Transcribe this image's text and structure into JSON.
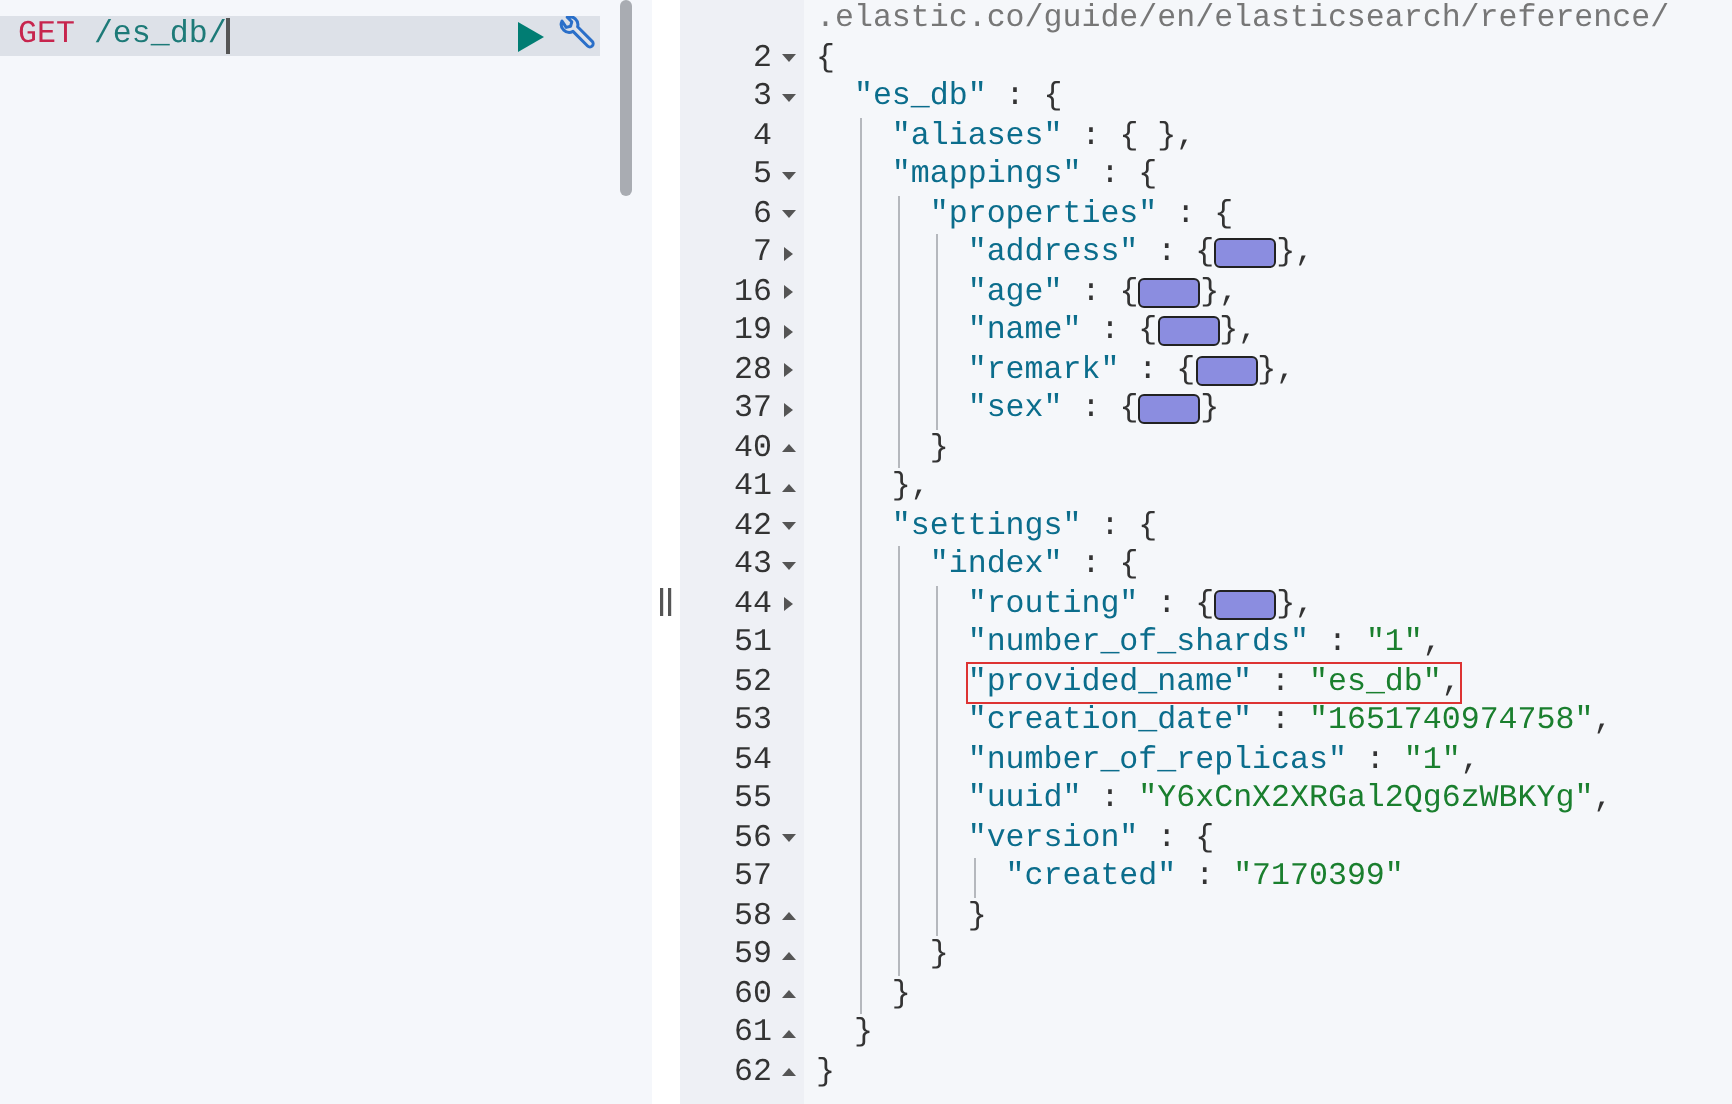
{
  "request": {
    "method": "GET",
    "path": "/es_db/"
  },
  "response": {
    "rows": [
      {
        "line": "",
        "fold_start": false,
        "fold_end": false,
        "code": [
          {
            "kind": "comment",
            "text": ".elastic.co/guide/en/elasticsearch/reference/"
          }
        ]
      },
      {
        "line": "2",
        "fold_start": true,
        "expanded": true,
        "fold_end": false,
        "code": [
          {
            "kind": "punct",
            "text": "{"
          }
        ]
      },
      {
        "line": "3",
        "fold_start": true,
        "expanded": true,
        "fold_end": false,
        "code": [
          {
            "kind": "key",
            "text": "  \"es_db\""
          },
          {
            "kind": "punct",
            "text": " : {"
          }
        ]
      },
      {
        "line": "4",
        "fold_start": false,
        "fold_end": false,
        "code": [
          {
            "kind": "key",
            "text": "    \"aliases\""
          },
          {
            "kind": "punct",
            "text": " : { },"
          }
        ]
      },
      {
        "line": "5",
        "fold_start": true,
        "expanded": true,
        "fold_end": false,
        "code": [
          {
            "kind": "key",
            "text": "    \"mappings\""
          },
          {
            "kind": "punct",
            "text": " : {"
          }
        ]
      },
      {
        "line": "6",
        "fold_start": true,
        "expanded": true,
        "fold_end": false,
        "code": [
          {
            "kind": "key",
            "text": "      \"properties\""
          },
          {
            "kind": "punct",
            "text": " : {"
          }
        ]
      },
      {
        "line": "7",
        "fold_start": true,
        "expanded": false,
        "fold_end": false,
        "code": [
          {
            "kind": "key",
            "text": "        \"address\""
          },
          {
            "kind": "punct",
            "text": " : {"
          },
          {
            "kind": "widget"
          },
          {
            "kind": "punct",
            "text": "},"
          }
        ]
      },
      {
        "line": "16",
        "fold_start": true,
        "expanded": false,
        "fold_end": false,
        "code": [
          {
            "kind": "key",
            "text": "        \"age\""
          },
          {
            "kind": "punct",
            "text": " : {"
          },
          {
            "kind": "widget"
          },
          {
            "kind": "punct",
            "text": "},"
          }
        ]
      },
      {
        "line": "19",
        "fold_start": true,
        "expanded": false,
        "fold_end": false,
        "code": [
          {
            "kind": "key",
            "text": "        \"name\""
          },
          {
            "kind": "punct",
            "text": " : {"
          },
          {
            "kind": "widget"
          },
          {
            "kind": "punct",
            "text": "},"
          }
        ]
      },
      {
        "line": "28",
        "fold_start": true,
        "expanded": false,
        "fold_end": false,
        "code": [
          {
            "kind": "key",
            "text": "        \"remark\""
          },
          {
            "kind": "punct",
            "text": " : {"
          },
          {
            "kind": "widget"
          },
          {
            "kind": "punct",
            "text": "},"
          }
        ]
      },
      {
        "line": "37",
        "fold_start": true,
        "expanded": false,
        "fold_end": false,
        "code": [
          {
            "kind": "key",
            "text": "        \"sex\""
          },
          {
            "kind": "punct",
            "text": " : {"
          },
          {
            "kind": "widget"
          },
          {
            "kind": "punct",
            "text": "}"
          }
        ]
      },
      {
        "line": "40",
        "fold_start": false,
        "fold_end": true,
        "code": [
          {
            "kind": "punct",
            "text": "      }"
          }
        ]
      },
      {
        "line": "41",
        "fold_start": false,
        "fold_end": true,
        "code": [
          {
            "kind": "punct",
            "text": "    },"
          }
        ]
      },
      {
        "line": "42",
        "fold_start": true,
        "expanded": true,
        "fold_end": false,
        "code": [
          {
            "kind": "key",
            "text": "    \"settings\""
          },
          {
            "kind": "punct",
            "text": " : {"
          }
        ]
      },
      {
        "line": "43",
        "fold_start": true,
        "expanded": true,
        "fold_end": false,
        "code": [
          {
            "kind": "key",
            "text": "      \"index\""
          },
          {
            "kind": "punct",
            "text": " : {"
          }
        ]
      },
      {
        "line": "44",
        "fold_start": true,
        "expanded": false,
        "fold_end": false,
        "code": [
          {
            "kind": "key",
            "text": "        \"routing\""
          },
          {
            "kind": "punct",
            "text": " : {"
          },
          {
            "kind": "widget"
          },
          {
            "kind": "punct",
            "text": "},"
          }
        ]
      },
      {
        "line": "51",
        "fold_start": false,
        "fold_end": false,
        "code": [
          {
            "kind": "key",
            "text": "        \"number_of_shards\""
          },
          {
            "kind": "punct",
            "text": " : "
          },
          {
            "kind": "value",
            "text": "\"1\""
          },
          {
            "kind": "punct",
            "text": ","
          }
        ]
      },
      {
        "line": "52",
        "fold_start": false,
        "fold_end": false,
        "highlighted": true,
        "code": [
          {
            "kind": "key",
            "text": "        \"provided_name\""
          },
          {
            "kind": "punct",
            "text": " : "
          },
          {
            "kind": "value",
            "text": "\"es_db\""
          },
          {
            "kind": "punct",
            "text": ","
          }
        ]
      },
      {
        "line": "53",
        "fold_start": false,
        "fold_end": false,
        "code": [
          {
            "kind": "key",
            "text": "        \"creation_date\""
          },
          {
            "kind": "punct",
            "text": " : "
          },
          {
            "kind": "value",
            "text": "\"1651740974758\""
          },
          {
            "kind": "punct",
            "text": ","
          }
        ]
      },
      {
        "line": "54",
        "fold_start": false,
        "fold_end": false,
        "code": [
          {
            "kind": "key",
            "text": "        \"number_of_replicas\""
          },
          {
            "kind": "punct",
            "text": " : "
          },
          {
            "kind": "value",
            "text": "\"1\""
          },
          {
            "kind": "punct",
            "text": ","
          }
        ]
      },
      {
        "line": "55",
        "fold_start": false,
        "fold_end": false,
        "code": [
          {
            "kind": "key",
            "text": "        \"uuid\""
          },
          {
            "kind": "punct",
            "text": " : "
          },
          {
            "kind": "value",
            "text": "\"Y6xCnX2XRGal2Qg6zWBKYg\""
          },
          {
            "kind": "punct",
            "text": ","
          }
        ]
      },
      {
        "line": "56",
        "fold_start": true,
        "expanded": true,
        "fold_end": false,
        "code": [
          {
            "kind": "key",
            "text": "        \"version\""
          },
          {
            "kind": "punct",
            "text": " : {"
          }
        ]
      },
      {
        "line": "57",
        "fold_start": false,
        "fold_end": false,
        "code": [
          {
            "kind": "key",
            "text": "          \"created\""
          },
          {
            "kind": "punct",
            "text": " : "
          },
          {
            "kind": "value",
            "text": "\"7170399\""
          }
        ]
      },
      {
        "line": "58",
        "fold_start": false,
        "fold_end": true,
        "code": [
          {
            "kind": "punct",
            "text": "        }"
          }
        ]
      },
      {
        "line": "59",
        "fold_start": false,
        "fold_end": true,
        "code": [
          {
            "kind": "punct",
            "text": "      }"
          }
        ]
      },
      {
        "line": "60",
        "fold_start": false,
        "fold_end": true,
        "code": [
          {
            "kind": "punct",
            "text": "    }"
          }
        ]
      },
      {
        "line": "61",
        "fold_start": false,
        "fold_end": true,
        "code": [
          {
            "kind": "punct",
            "text": "  }"
          }
        ]
      },
      {
        "line": "62",
        "fold_start": false,
        "fold_end": true,
        "code": [
          {
            "kind": "punct",
            "text": "}"
          }
        ]
      }
    ]
  }
}
